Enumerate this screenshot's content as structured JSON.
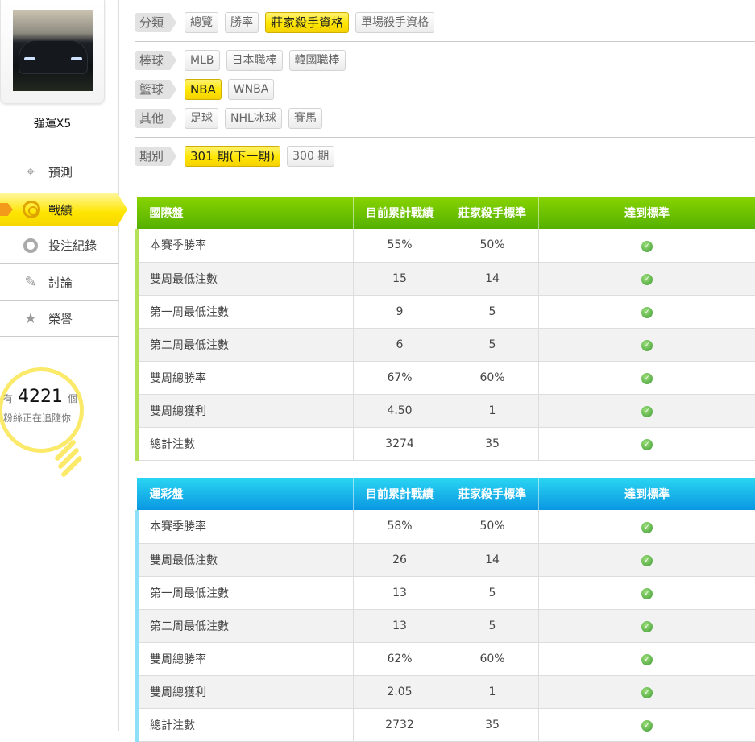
{
  "user": {
    "name": "強運X5"
  },
  "nav": [
    {
      "label": "預測",
      "icon": "crosshair-icon"
    },
    {
      "label": "戰績",
      "icon": "target-icon",
      "active": true
    },
    {
      "label": "投注紀錄",
      "icon": "circle-icon"
    },
    {
      "label": "討論",
      "icon": "chat-edit-icon"
    },
    {
      "label": "榮譽",
      "icon": "medal-icon"
    }
  ],
  "fans": {
    "prefix": "有",
    "count": "4221",
    "suffix": "個",
    "sub": "粉絲正在追隨你"
  },
  "filters": {
    "category": {
      "label": "分類",
      "options": [
        "總覽",
        "勝率",
        "莊家殺手資格",
        "單場殺手資格"
      ],
      "selected": 2
    },
    "baseball": {
      "label": "棒球",
      "options": [
        "MLB",
        "日本職棒",
        "韓國職棒"
      ]
    },
    "basketball": {
      "label": "籃球",
      "options": [
        "NBA",
        "WNBA"
      ],
      "selected": 0
    },
    "other": {
      "label": "其他",
      "options": [
        "足球",
        "NHL冰球",
        "賽馬"
      ]
    },
    "period": {
      "label": "期別",
      "options": [
        "301 期(下一期)",
        "300 期"
      ],
      "selected": 0
    }
  },
  "colors": {
    "accent": "#ffe600",
    "intl": "#55b000",
    "lottery": "#0a97e2",
    "check": "#3f9a36"
  },
  "tables": [
    {
      "title": "國際盤",
      "headers": [
        "目前累計戰績",
        "莊家殺手標準",
        "達到標準"
      ],
      "rows": [
        [
          "本賽季勝率",
          "55%",
          "50%"
        ],
        [
          "雙周最低注數",
          "15",
          "14"
        ],
        [
          "第一周最低注數",
          "9",
          "5"
        ],
        [
          "第二周最低注數",
          "6",
          "5"
        ],
        [
          "雙周總勝率",
          "67%",
          "60%"
        ],
        [
          "雙周總獲利",
          "4.50",
          "1"
        ],
        [
          "總計注數",
          "3274",
          "35"
        ]
      ],
      "met": [
        true,
        true,
        true,
        true,
        true,
        true,
        true
      ]
    },
    {
      "title": "運彩盤",
      "headers": [
        "目前累計戰績",
        "莊家殺手標準",
        "達到標準"
      ],
      "rows": [
        [
          "本賽季勝率",
          "58%",
          "50%"
        ],
        [
          "雙周最低注數",
          "26",
          "14"
        ],
        [
          "第一周最低注數",
          "13",
          "5"
        ],
        [
          "第二周最低注數",
          "13",
          "5"
        ],
        [
          "雙周總勝率",
          "62%",
          "60%"
        ],
        [
          "雙周總獲利",
          "2.05",
          "1"
        ],
        [
          "總計注數",
          "2732",
          "35"
        ]
      ],
      "met": [
        true,
        true,
        true,
        true,
        true,
        true,
        true
      ]
    }
  ]
}
